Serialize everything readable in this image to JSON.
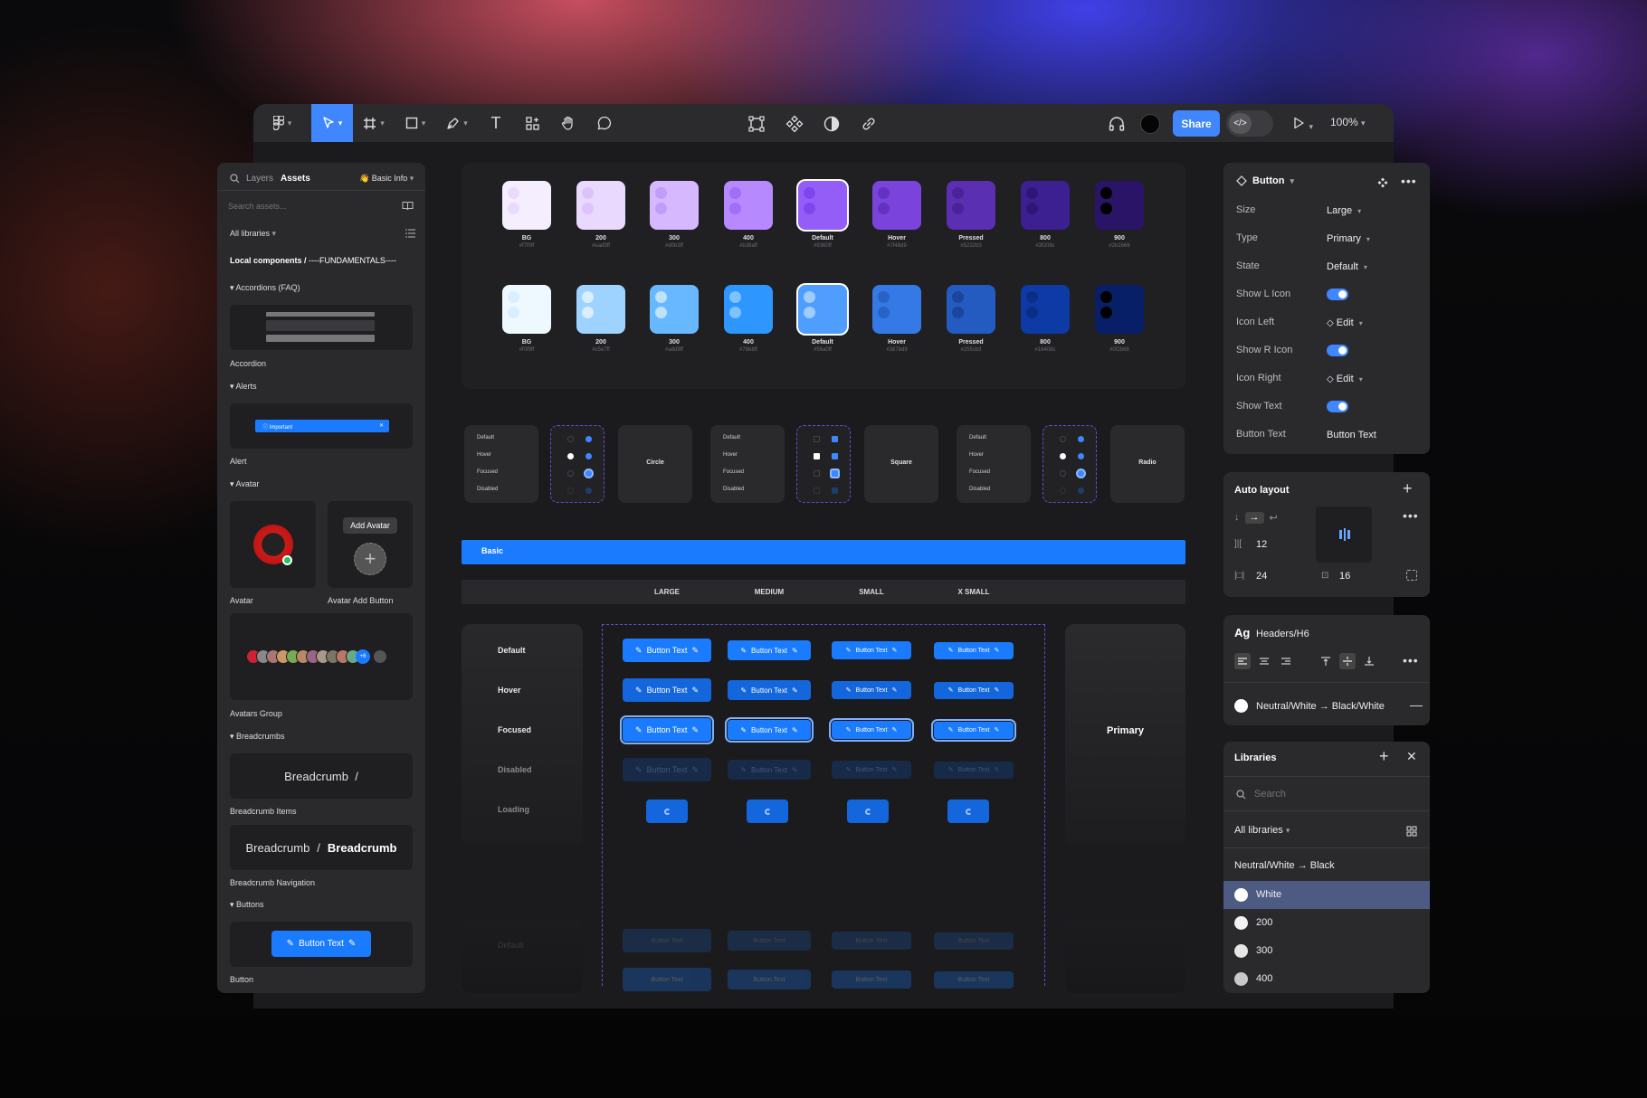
{
  "toolbar": {
    "share_label": "Share",
    "dev_label": "</>",
    "zoom": "100%",
    "text_tool": "T"
  },
  "assets_panel": {
    "tab_layers": "Layers",
    "tab_assets": "Assets",
    "basic_info": "👋 Basic Info",
    "search_placeholder": "Search assets...",
    "all_libraries": "All libraries",
    "breadcrumb_prefix": "Local components /",
    "breadcrumb_current": "----FUNDAMENTALS----",
    "sections": {
      "accordions": "Accordions (FAQ)",
      "alerts": "Alerts",
      "avatar": "Avatar",
      "breadcrumbs": "Breadcrumbs",
      "buttons": "Buttons"
    },
    "components": {
      "accordion": "Accordion",
      "alert": "Alert",
      "alert_text": "Important",
      "avatar": "Avatar",
      "avatar_add": "Avatar Add Button",
      "add_avatar_tooltip": "Add Avatar",
      "avatars_group": "Avatars Group",
      "avatars_more": "+6",
      "breadcrumb_items": "Breadcrumb Items",
      "breadcrumb_items_preview": "Breadcrumb  /",
      "breadcrumb_nav": "Breadcrumb Navigation",
      "breadcrumb_nav_a": "Breadcrumb",
      "breadcrumb_nav_sep": "/",
      "breadcrumb_nav_b": "Breadcrumb",
      "button": "Button",
      "button_preview": "Button Text"
    }
  },
  "palette": {
    "purple": [
      {
        "label": "BG",
        "hex": "#f7f0ff",
        "color": "#f5eefe",
        "dot": "#e9dcfb"
      },
      {
        "label": "200",
        "hex": "#ead9ff",
        "color": "#ead9fe",
        "dot": "#dcc4fb"
      },
      {
        "label": "300",
        "hex": "#d0b3ff",
        "color": "#d5b8ff",
        "dot": "#c29cf9"
      },
      {
        "label": "400",
        "hex": "#b38aff",
        "color": "#b689ff",
        "dot": "#a16ef7"
      },
      {
        "label": "Default",
        "hex": "#9360ff",
        "color": "#945df7",
        "dot": "#7f46ee"
      },
      {
        "label": "Hover",
        "hex": "#7f48d9",
        "color": "#7a43dc",
        "dot": "#6332c0"
      },
      {
        "label": "Pressed",
        "hex": "#5232b3",
        "color": "#5a2fb2",
        "dot": "#4a2399"
      },
      {
        "label": "800",
        "hex": "#3f208c",
        "color": "#3c1f91",
        "dot": "#2e1677"
      },
      {
        "label": "900",
        "hex": "#2b1666",
        "color": "#2a1468",
        "dot": "#000000"
      }
    ],
    "blue": [
      {
        "label": "BG",
        "hex": "#f0f9ff",
        "color": "#eef8ff",
        "dot": "#d9efff"
      },
      {
        "label": "200",
        "hex": "#c5e7ff",
        "color": "#9fd3ff",
        "dot": "#d9efff"
      },
      {
        "label": "300",
        "hex": "#a8d9ff",
        "color": "#68b8ff",
        "dot": "#bfe2ff"
      },
      {
        "label": "400",
        "hex": "#78b8ff",
        "color": "#2e97ff",
        "dot": "#7fc2ff"
      },
      {
        "label": "Default",
        "hex": "#56a0ff",
        "color": "#4e9dff",
        "dot": "#9fcdff"
      },
      {
        "label": "Hover",
        "hex": "#387bd9",
        "color": "#3479e6",
        "dot": "#2863c4"
      },
      {
        "label": "Pressed",
        "hex": "#255cb3",
        "color": "#245bc0",
        "dot": "#1a469b"
      },
      {
        "label": "800",
        "hex": "#16408c",
        "color": "#0e3aa6",
        "dot": "#0a2d86"
      },
      {
        "label": "900",
        "hex": "#0f2b66",
        "color": "#071f66",
        "dot": "#000000"
      }
    ]
  },
  "controls": {
    "states": [
      "Default",
      "Hover",
      "Focused",
      "Disabled"
    ],
    "circle": "Circle",
    "square": "Square",
    "radio": "Radio"
  },
  "button_sheet": {
    "header": "Basic",
    "sizes": [
      "LARGE",
      "MEDIUM",
      "SMALL",
      "X SMALL"
    ],
    "states": [
      "Default",
      "Hover",
      "Focused",
      "Disabled",
      "Loading"
    ],
    "button_text": "Button Text",
    "primary_label": "Primary",
    "faded_state": "Default"
  },
  "properties": {
    "component": "Button",
    "rows": [
      {
        "label": "Size",
        "value": "Large"
      },
      {
        "label": "Type",
        "value": "Primary"
      },
      {
        "label": "State",
        "value": "Default"
      },
      {
        "label": "Show L Icon",
        "value": ""
      },
      {
        "label": "Icon Left",
        "value": "Edit"
      },
      {
        "label": "Show R Icon",
        "value": ""
      },
      {
        "label": "Icon Right",
        "value": "Edit"
      },
      {
        "label": "Show Text",
        "value": ""
      },
      {
        "label": "Button Text",
        "value": "Button Text"
      }
    ]
  },
  "auto_layout": {
    "title": "Auto layout",
    "gap": "12",
    "padding_h": "24",
    "padding_v": "16"
  },
  "typography": {
    "ag": "Ag",
    "style": "Headers/H6",
    "fill": "Neutral/White → Black/White"
  },
  "libraries": {
    "title": "Libraries",
    "search_placeholder": "Search",
    "all_libraries": "All libraries",
    "group": "Neutral/White → Black",
    "items": [
      {
        "label": "White",
        "color": "#ffffff"
      },
      {
        "label": "200",
        "color": "#f2f2f2"
      },
      {
        "label": "300",
        "color": "#e6e6e6"
      },
      {
        "label": "400",
        "color": "#c8c8c8"
      }
    ]
  }
}
